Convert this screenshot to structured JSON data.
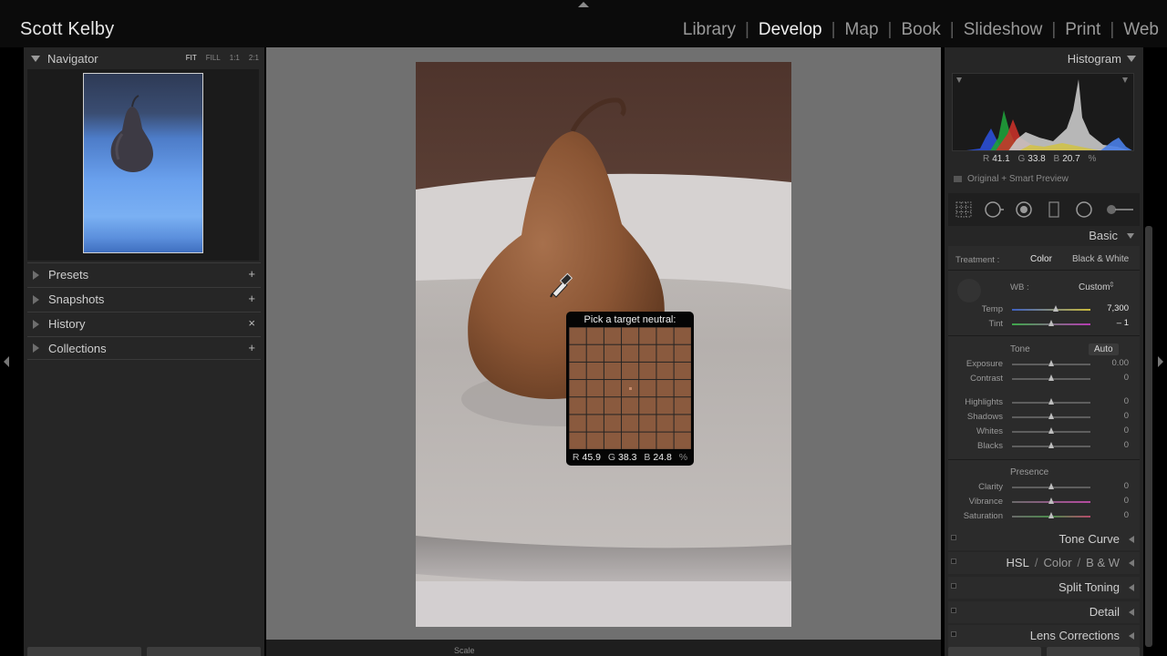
{
  "identity_plate": "Scott Kelby",
  "modules": [
    {
      "label": "Library",
      "active": false
    },
    {
      "label": "Develop",
      "active": true
    },
    {
      "label": "Map",
      "active": false
    },
    {
      "label": "Book",
      "active": false
    },
    {
      "label": "Slideshow",
      "active": false
    },
    {
      "label": "Print",
      "active": false
    },
    {
      "label": "Web",
      "active": false
    }
  ],
  "navigator": {
    "title": "Navigator",
    "zoom_options": [
      "FIT",
      "FILL",
      "1:1",
      "2:1"
    ],
    "active_zoom": "FIT"
  },
  "left_panels": [
    {
      "label": "Presets",
      "action": "+"
    },
    {
      "label": "Snapshots",
      "action": "+"
    },
    {
      "label": "History",
      "action": "×"
    },
    {
      "label": "Collections",
      "action": "+"
    }
  ],
  "loupe": {
    "title": "Pick a target neutral:",
    "r": "45.9",
    "g": "38.3",
    "b": "24.8",
    "unit": "%"
  },
  "histogram": {
    "title": "Histogram",
    "r": "41.1",
    "g": "33.8",
    "b": "20.7",
    "unit": "%",
    "preview_label": "Original + Smart Preview"
  },
  "basic": {
    "title": "Basic",
    "treatment_label": "Treatment :",
    "treatment_color": "Color",
    "treatment_bw": "Black & White",
    "wb_label": "WB :",
    "wb_value": "Custom",
    "temp_label": "Temp",
    "temp_value": "7,300",
    "temp_pos": 0.56,
    "tint_label": "Tint",
    "tint_value": "– 1",
    "tint_pos": 0.5,
    "tone_label": "Tone",
    "auto_label": "Auto",
    "sliders_tone": [
      {
        "label": "Exposure",
        "value": "0.00"
      },
      {
        "label": "Contrast",
        "value": "0"
      }
    ],
    "sliders_tone2": [
      {
        "label": "Highlights",
        "value": "0"
      },
      {
        "label": "Shadows",
        "value": "0"
      },
      {
        "label": "Whites",
        "value": "0"
      },
      {
        "label": "Blacks",
        "value": "0"
      }
    ],
    "presence_label": "Presence",
    "sliders_presence": [
      {
        "label": "Clarity",
        "value": "0"
      },
      {
        "label": "Vibrance",
        "value": "0"
      },
      {
        "label": "Saturation",
        "value": "0"
      }
    ]
  },
  "collapsed_panels": {
    "tone_curve": "Tone Curve",
    "hsl": "HSL",
    "color": "Color",
    "bw": "B & W",
    "split_toning": "Split Toning",
    "detail": "Detail",
    "lens_corrections": "Lens Corrections"
  },
  "bottom_toolbar": {
    "scale_label": "Scale"
  },
  "colors": {
    "panel_bg": "#262626",
    "center_bg": "#707070",
    "loupe_swatch": "#8a5a3e"
  }
}
